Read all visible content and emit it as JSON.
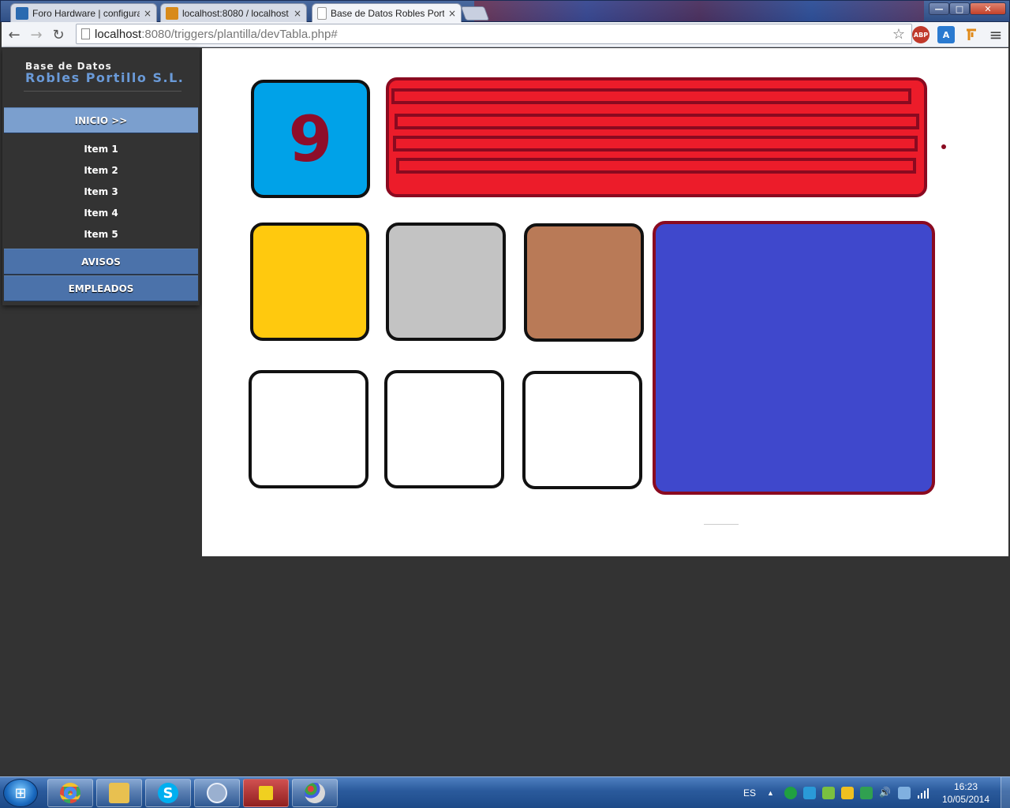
{
  "browser": {
    "tabs": [
      {
        "label": "Foro Hardware | configura",
        "icon_color": "#2a6ab0",
        "active": false
      },
      {
        "label": "localhost:8080 / localhost",
        "icon_color": "#d88a1a",
        "active": false
      },
      {
        "label": "Base de Datos Robles Port",
        "icon_color": "#ffffff",
        "active": true
      }
    ],
    "tab_close": "×",
    "window_controls": {
      "minimize": "—",
      "maximize": "□",
      "close": "✕"
    },
    "nav": {
      "back": "←",
      "forward": "→",
      "reload": "↻",
      "menu": "≡"
    },
    "url_host": "localhost",
    "url_rest": ":8080/triggers/plantilla/devTabla.php#",
    "bookmark_star": "☆",
    "extensions": [
      {
        "name": "abp-icon",
        "label": "ABP",
        "color": "#c0392b"
      },
      {
        "name": "translate-icon",
        "label": "A",
        "color": "#2a7ad0"
      },
      {
        "name": "pin-icon",
        "label": "",
        "color": "#e08a1a"
      }
    ]
  },
  "sidebar": {
    "brand_small": "Base de Datos",
    "brand_big": "Robles Portillo S.L.",
    "menu": [
      {
        "label": "INICIO >>",
        "active": true
      },
      {
        "label": "AVISOS",
        "active": false
      },
      {
        "label": "EMPLEADOS",
        "active": false
      }
    ],
    "subitems": [
      "Item 1",
      "Item 2",
      "Item 3",
      "Item 4",
      "Item 5"
    ]
  },
  "content": {
    "number_tile": "9",
    "colors": {
      "number_tile": "#00a2e8",
      "yellow": "#ffc90e",
      "gray": "#c3c3c3",
      "brown": "#b97a57",
      "white": "#ffffff",
      "blue_panel": "#3f48cc",
      "red_panel": "#ec1c2a",
      "dark_red": "#8a0a20"
    }
  },
  "taskbar": {
    "start": "⊞",
    "apps": [
      {
        "name": "chrome-icon",
        "color": "#e04b3a"
      },
      {
        "name": "explorer-icon",
        "color": "#e8c050"
      },
      {
        "name": "skype-icon",
        "color": "#00aff0"
      },
      {
        "name": "app-circle-icon",
        "color": "#9ab0d0"
      },
      {
        "name": "warning-app-icon",
        "color": "#c03030"
      },
      {
        "name": "paint-icon",
        "color": "#d8d8d8"
      }
    ],
    "language": "ES",
    "tray_arrow": "▲",
    "time": "16:23",
    "date": "10/05/2014"
  }
}
